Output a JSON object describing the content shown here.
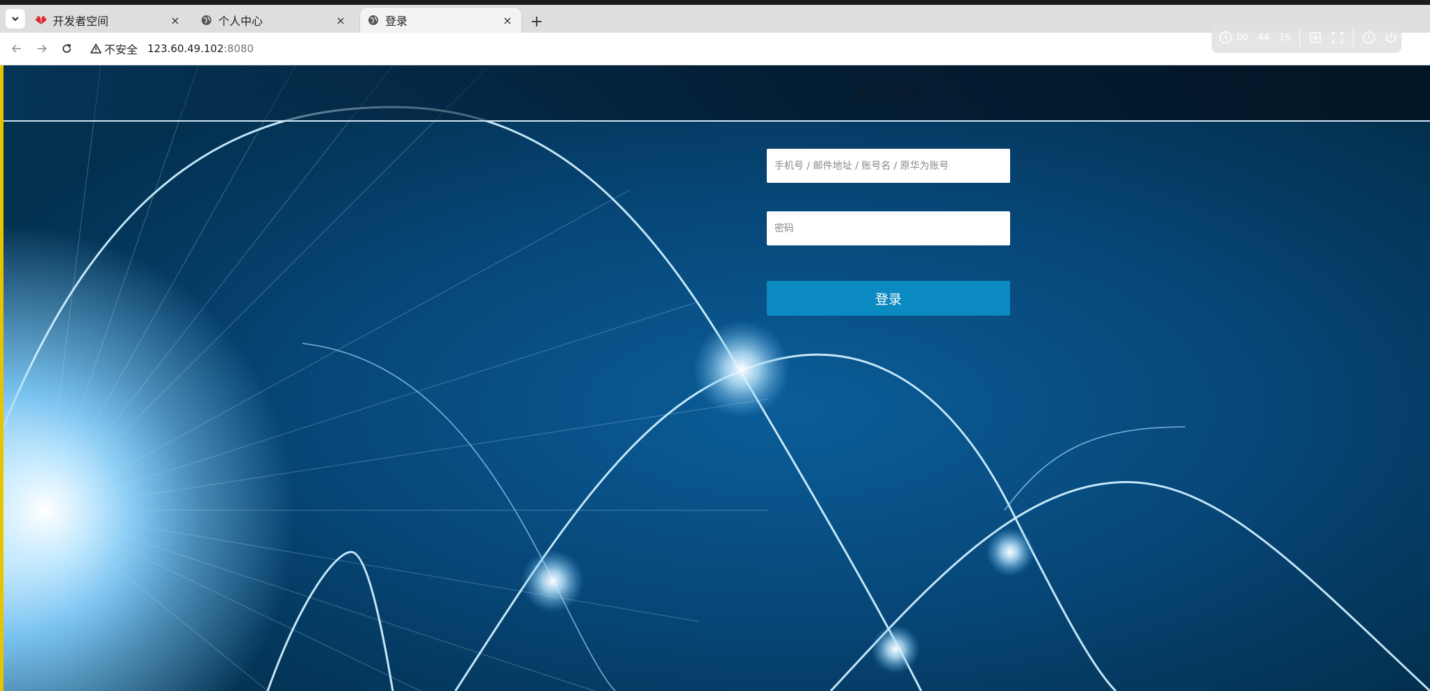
{
  "browser": {
    "tabs": [
      {
        "title": "开发者空间",
        "icon": "huawei-icon",
        "active": false
      },
      {
        "title": "个人中心",
        "icon": "globe-icon",
        "active": false
      },
      {
        "title": "登录",
        "icon": "globe-icon",
        "active": true
      }
    ],
    "new_tab_label": "+",
    "close_label": "×",
    "address": {
      "security_label": "不安全",
      "host": "123.60.49.102",
      "port": ":8080"
    }
  },
  "recorder": {
    "hours": "00",
    "minutes": "44",
    "seconds": "16"
  },
  "page": {
    "title": "账号登陆",
    "account_placeholder": "手机号 / 邮件地址 / 账号名 / 原华为账号",
    "password_placeholder": "密码",
    "login_button": "登录"
  },
  "colors": {
    "button": "#0a8ac0",
    "background": "#054a7c"
  }
}
